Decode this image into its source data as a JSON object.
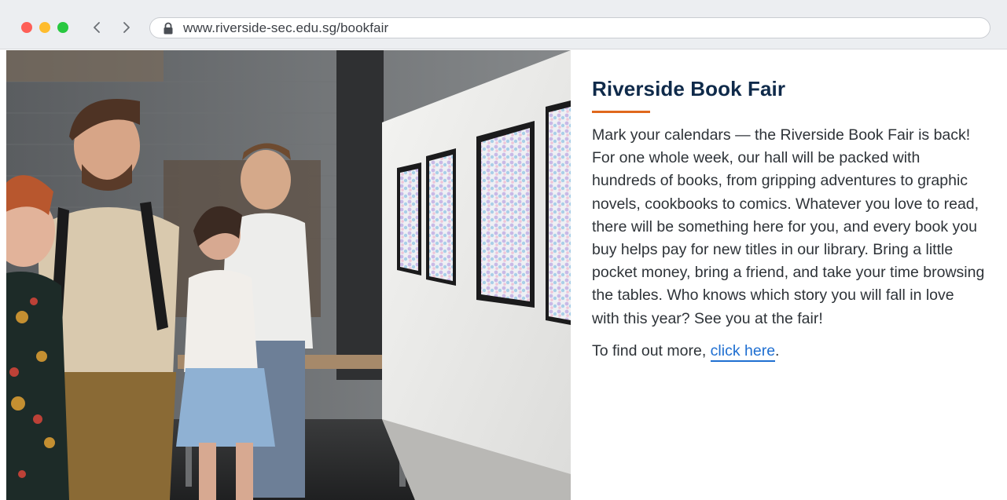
{
  "browser": {
    "url": "www.riverside-sec.edu.sg/bookfair",
    "icons": {
      "back": "chevron-left-icon",
      "forward": "chevron-right-icon",
      "lock": "lock-icon"
    },
    "traffic_colors": [
      "#fe5f57",
      "#febc2e",
      "#28c840"
    ]
  },
  "page": {
    "title": "Riverside Book Fair",
    "body": "Mark your calendars — the Riverside Book Fair is back! For one whole week, our hall will be packed with hundreds of books, from gripping adventures to graphic novels, cookbooks to comics. Whatever you love to read, there will be something here for you, and every book you buy helps pay for new titles in our library. Bring a little pocket money, bring a friend, and take your time browsing the tables. Who knows which story you will fall in love with this year? See you at the fair!",
    "more_prefix": "To find out more, ",
    "link_label": "click here",
    "more_suffix": "."
  },
  "colors": {
    "title": "#0f2a4a",
    "accent": "#e0681c",
    "link": "#1f6fd1"
  }
}
